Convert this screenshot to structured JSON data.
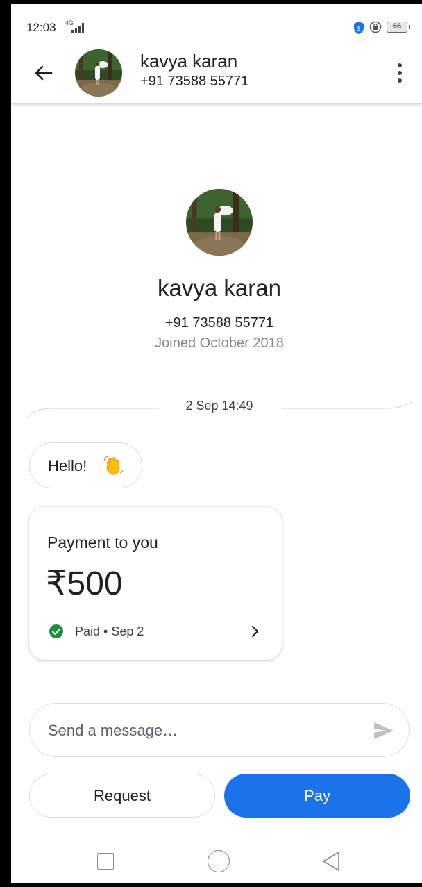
{
  "status_bar": {
    "time": "12:03",
    "network": "4G",
    "battery": "66"
  },
  "header": {
    "name": "kavya karan",
    "phone": "+91 73588 55771"
  },
  "profile": {
    "name": "kavya karan",
    "phone": "+91 73588 55771",
    "joined": "Joined October 2018"
  },
  "conversation": {
    "date_label": "2 Sep 14:49",
    "message_text": "Hello!",
    "message_emoji_icon": "waving-hand-icon"
  },
  "payment_card": {
    "title": "Payment to you",
    "amount": "₹500",
    "status": "Paid • Sep 2"
  },
  "composer": {
    "placeholder": "Send a message…"
  },
  "actions": {
    "request_label": "Request",
    "pay_label": "Pay"
  },
  "colors": {
    "primary_blue": "#1a73e8",
    "paid_green": "#1e8e3e",
    "border_gray": "#dadce0",
    "secondary_text": "#80868b"
  },
  "icons": [
    "back-arrow-icon",
    "more-vert-icon",
    "waving-hand-icon",
    "check-circle-icon",
    "chevron-right-icon",
    "send-icon",
    "shield-icon",
    "vpn-icon",
    "signal-icon"
  ]
}
